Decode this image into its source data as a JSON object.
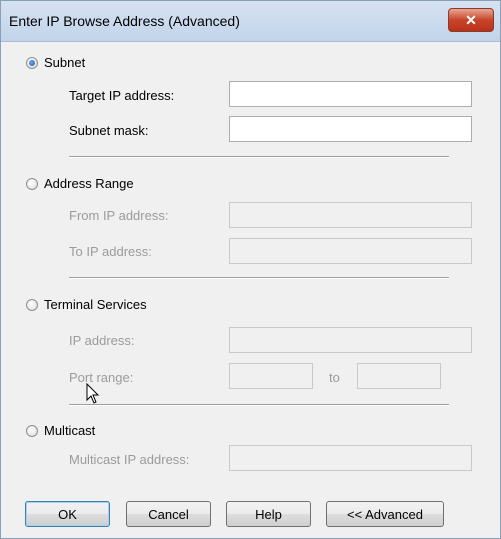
{
  "window": {
    "title": "Enter IP Browse Address (Advanced)",
    "close_glyph": "✕"
  },
  "subnet": {
    "label": "Subnet",
    "selected": true,
    "target_label": "Target IP address:",
    "target_value": "",
    "mask_label": "Subnet mask:",
    "mask_value": ""
  },
  "address_range": {
    "label": "Address Range",
    "selected": false,
    "from_label": "From IP address:",
    "to_label": "To IP address:"
  },
  "terminal_services": {
    "label": "Terminal Services",
    "selected": false,
    "ip_label": "IP address:",
    "port_label": "Port range:",
    "to_label": "to"
  },
  "multicast": {
    "label": "Multicast",
    "selected": false,
    "ip_label": "Multicast IP address:"
  },
  "buttons": {
    "ok": "OK",
    "cancel": "Cancel",
    "help": "Help",
    "advanced": "<< Advanced"
  }
}
